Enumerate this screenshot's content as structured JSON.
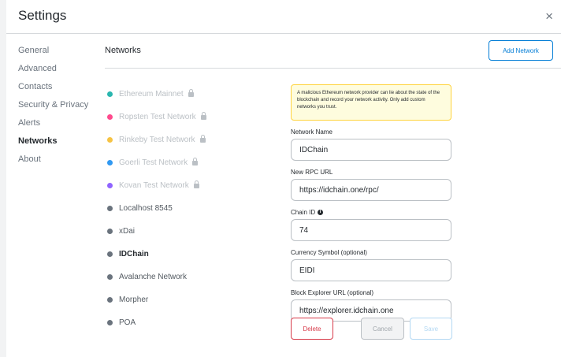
{
  "header": {
    "title": "Settings",
    "close_symbol": "×"
  },
  "tabs": [
    {
      "label": "General",
      "active": false
    },
    {
      "label": "Advanced",
      "active": false
    },
    {
      "label": "Contacts",
      "active": false
    },
    {
      "label": "Security & Privacy",
      "active": false
    },
    {
      "label": "Alerts",
      "active": false
    },
    {
      "label": "Networks",
      "active": true
    },
    {
      "label": "About",
      "active": false
    }
  ],
  "networks_page": {
    "title": "Networks",
    "add_button": "Add Network"
  },
  "networks": [
    {
      "label": "Ethereum Mainnet",
      "color": "#29b6af",
      "builtin": true
    },
    {
      "label": "Ropsten Test Network",
      "color": "#ff4a8d",
      "builtin": true
    },
    {
      "label": "Rinkeby Test Network",
      "color": "#f6c343",
      "builtin": true
    },
    {
      "label": "Goerli Test Network",
      "color": "#3099f2",
      "builtin": true
    },
    {
      "label": "Kovan Test Network",
      "color": "#9064ff",
      "builtin": true
    },
    {
      "label": "Localhost 8545",
      "color": "#6a737d",
      "builtin": false
    },
    {
      "label": "xDai",
      "color": "#6a737d",
      "builtin": false
    },
    {
      "label": "IDChain",
      "color": "#6a737d",
      "builtin": false,
      "selected": true
    },
    {
      "label": "Avalanche Network",
      "color": "#6a737d",
      "builtin": false
    },
    {
      "label": "Morpher",
      "color": "#6a737d",
      "builtin": false
    },
    {
      "label": "POA",
      "color": "#6a737d",
      "builtin": false
    }
  ],
  "form": {
    "warning": "A malicious Ethereum network provider can lie about the state of the blockchain and record your network activity. Only add custom networks you trust.",
    "network_name": {
      "label": "Network Name",
      "value": "IDChain"
    },
    "rpc_url": {
      "label": "New RPC URL",
      "value": "https://idchain.one/rpc/"
    },
    "chain_id": {
      "label": "Chain ID",
      "value": "74",
      "info_symbol": "i"
    },
    "currency_symbol": {
      "label": "Currency Symbol (optional)",
      "value": "EIDI"
    },
    "block_explorer": {
      "label": "Block Explorer URL (optional)",
      "value": "https://explorer.idchain.one"
    }
  },
  "actions": {
    "delete": "Delete",
    "cancel": "Cancel",
    "save": "Save"
  }
}
